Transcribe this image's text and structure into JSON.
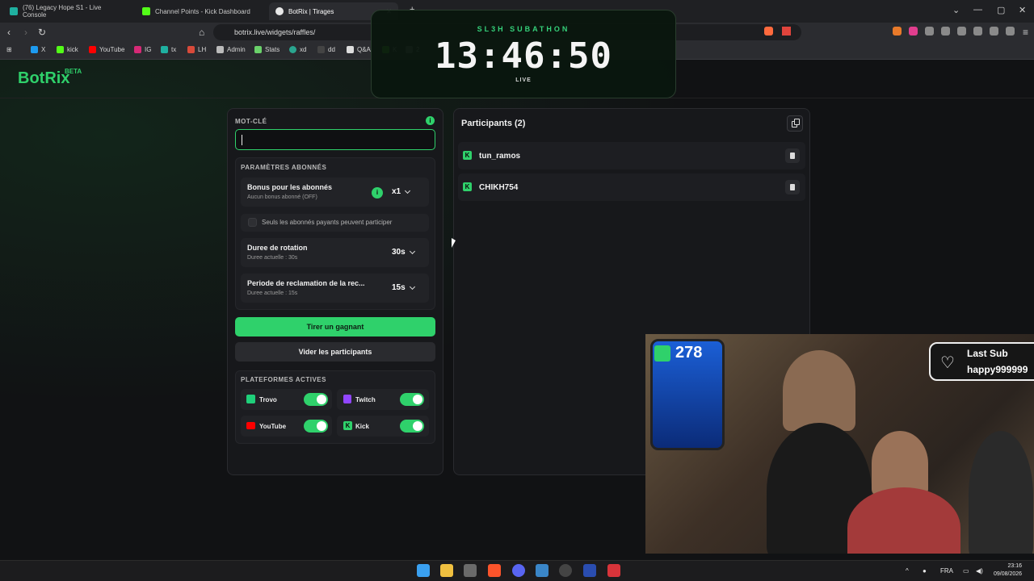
{
  "browser": {
    "tabs": [
      {
        "label": "(76) Legacy Hope S1 - Live Console"
      },
      {
        "label": "Channel Points - Kick Dashboard"
      },
      {
        "label": "BotRix | Tirages"
      }
    ],
    "url": "botrix.live/widgets/raffles/",
    "bookmarks": [
      "X",
      "kick",
      "YouTube",
      "IG",
      "tx",
      "LH",
      "Admin",
      "Stats",
      "xd",
      "dd",
      "Q&A",
      "K",
      "2"
    ]
  },
  "site": {
    "logo": "BotRix",
    "badge": "BETA"
  },
  "raffle": {
    "keyword_label": "MOT-CLÉ",
    "keyword_value": "",
    "subs_section": "PARAMÈTRES ABONNÉS",
    "bonus_title": "Bonus pour les abonnés",
    "bonus_sub": "Aucun bonus abonné (OFF)",
    "bonus_value": "x1",
    "paid_only": "Seuls les abonnés payants peuvent participer",
    "rotation_title": "Duree de rotation",
    "rotation_sub": "Duree actuelle : 30s",
    "rotation_value": "30s",
    "claim_title": "Periode de reclamation de la rec...",
    "claim_sub": "Duree actuelle : 15s",
    "claim_value": "15s",
    "draw_button": "Tirer un gagnant",
    "clear_button": "Vider les participants",
    "platforms_section": "PLATEFORMES ACTIVES",
    "platforms": [
      {
        "name": "Trovo",
        "enabled": true,
        "color": "#1fd07a"
      },
      {
        "name": "Twitch",
        "enabled": true,
        "color": "#9146ff"
      },
      {
        "name": "YouTube",
        "enabled": true,
        "color": "#ff0000"
      },
      {
        "name": "Kick",
        "enabled": true,
        "color": "#53fc18"
      }
    ]
  },
  "participants": {
    "title": "Participants (2)",
    "list": [
      {
        "name": "tun_ramos",
        "icon": "kick-icon"
      },
      {
        "name": "CHIKH754",
        "icon": "kick-icon"
      }
    ]
  },
  "overlay": {
    "title": "SL3H SUBATHON",
    "time": "13:46:50",
    "status": "LIVE",
    "viewers": "278",
    "last_sub_title": "Last Sub",
    "last_sub_name": "happy999999"
  },
  "taskbar": {
    "lang": "FRA",
    "time": "23:16",
    "date": "09/08/2026"
  }
}
